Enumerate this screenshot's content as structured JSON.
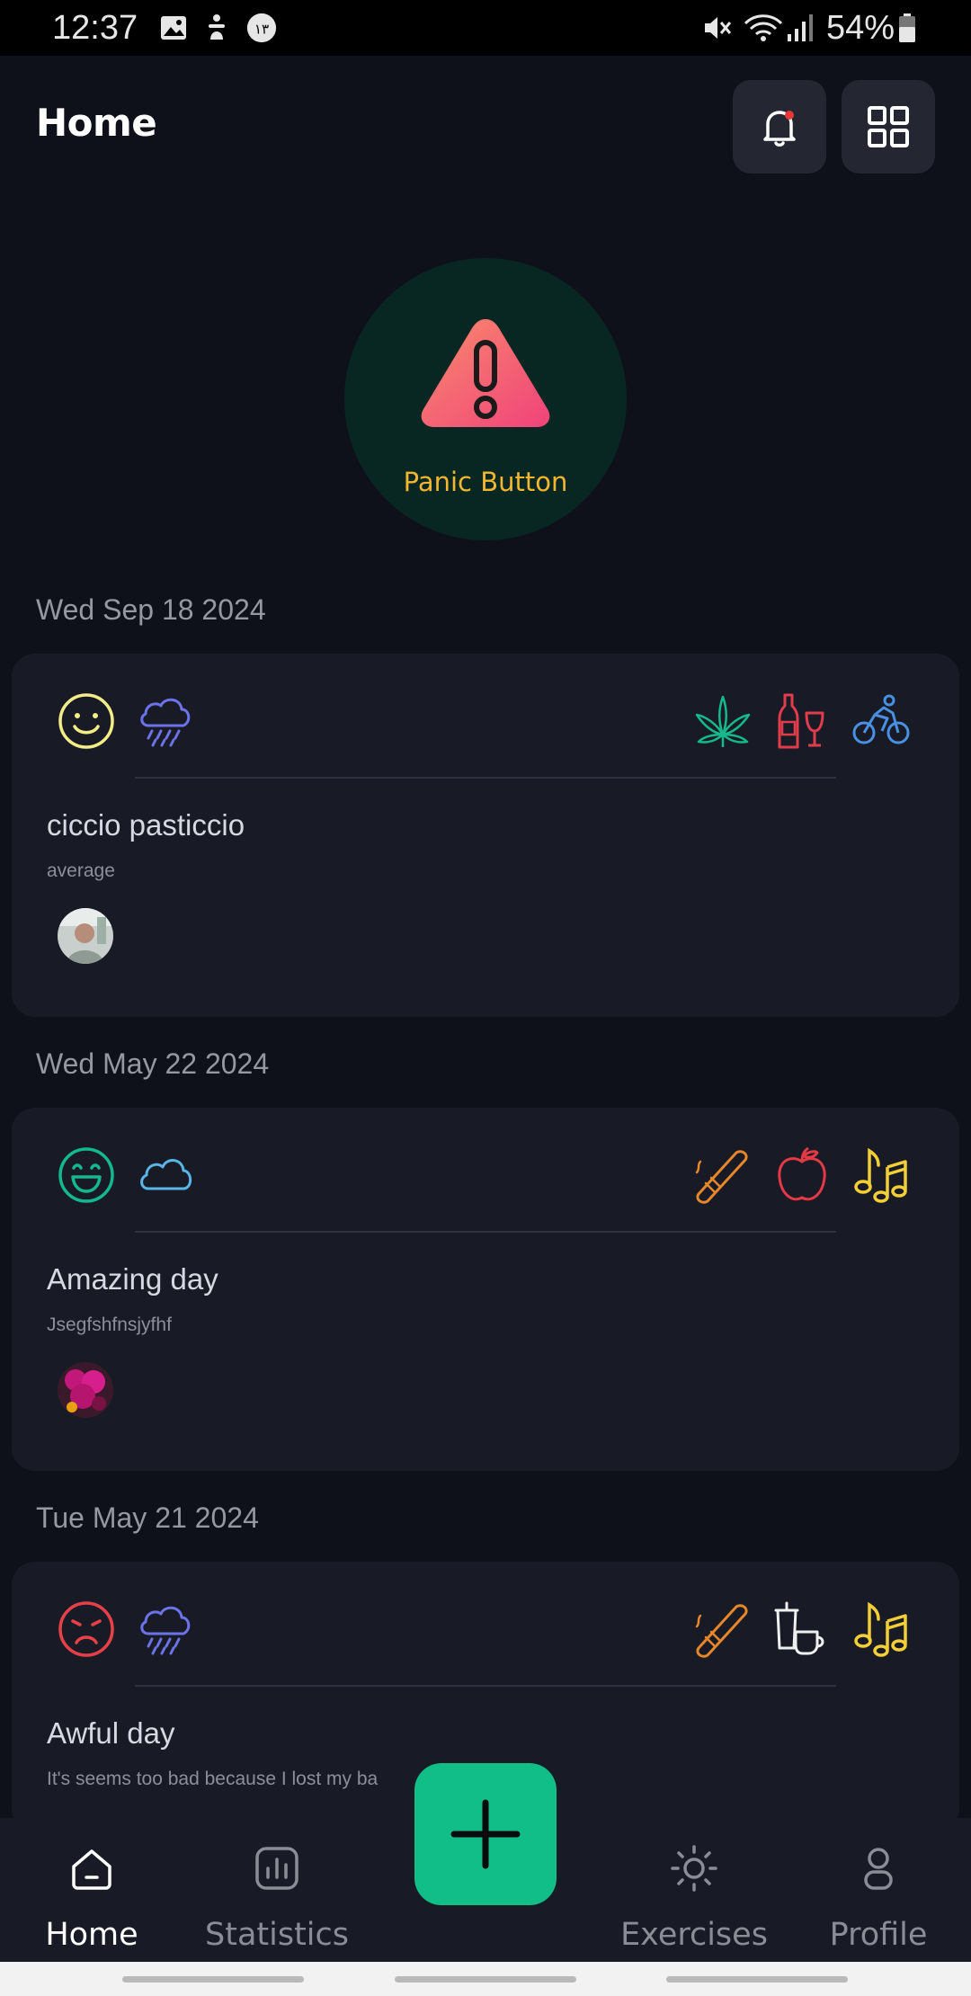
{
  "status_bar": {
    "time": "12:37",
    "battery": "54%",
    "notification_icons": [
      "image-icon",
      "accessibility-icon",
      "badge-13-icon"
    ],
    "system_icons": [
      "mute-icon",
      "wifi-icon",
      "signal-icon",
      "battery-icon"
    ]
  },
  "header": {
    "title": "Home",
    "buttons": [
      "bell-icon",
      "grid-icon"
    ]
  },
  "panic": {
    "label": "Panic Button",
    "color": "#f2b630"
  },
  "entries": [
    {
      "date": "Wed Sep 18 2024",
      "mood": "smile-icon",
      "weather": "rain-cloud-icon",
      "activities": [
        "cannabis-leaf-icon",
        "wine-icon",
        "cycling-icon"
      ],
      "title": "ciccio pasticcio",
      "note": "average"
    },
    {
      "date": "Wed May 22 2024",
      "mood": "grin-icon",
      "weather": "cloud-icon",
      "activities": [
        "cigar-icon",
        "apple-icon",
        "music-notes-icon"
      ],
      "title": "Amazing day",
      "note": "Jsegfshfnsjyfhf"
    },
    {
      "date": "Tue May 21 2024",
      "mood": "sad-face-icon",
      "weather": "rain-cloud-icon",
      "activities": [
        "cigar-icon",
        "coffee-icon",
        "music-notes-icon"
      ],
      "title": "Awful day",
      "note": "It's seems too bad because I lost my ba"
    }
  ],
  "nav": {
    "items": [
      {
        "label": "Home",
        "icon": "home-icon",
        "active": true
      },
      {
        "label": "Statistics",
        "icon": "statistics-icon",
        "active": false
      },
      {
        "label": "Exercises",
        "icon": "sun-icon",
        "active": false
      },
      {
        "label": "Profile",
        "icon": "person-icon",
        "active": false
      }
    ],
    "fab_icon": "plus-icon"
  },
  "colors": {
    "background": "#0f111a",
    "card": "#181b26",
    "accent": "#12be87",
    "panic_circle": "#082622"
  }
}
